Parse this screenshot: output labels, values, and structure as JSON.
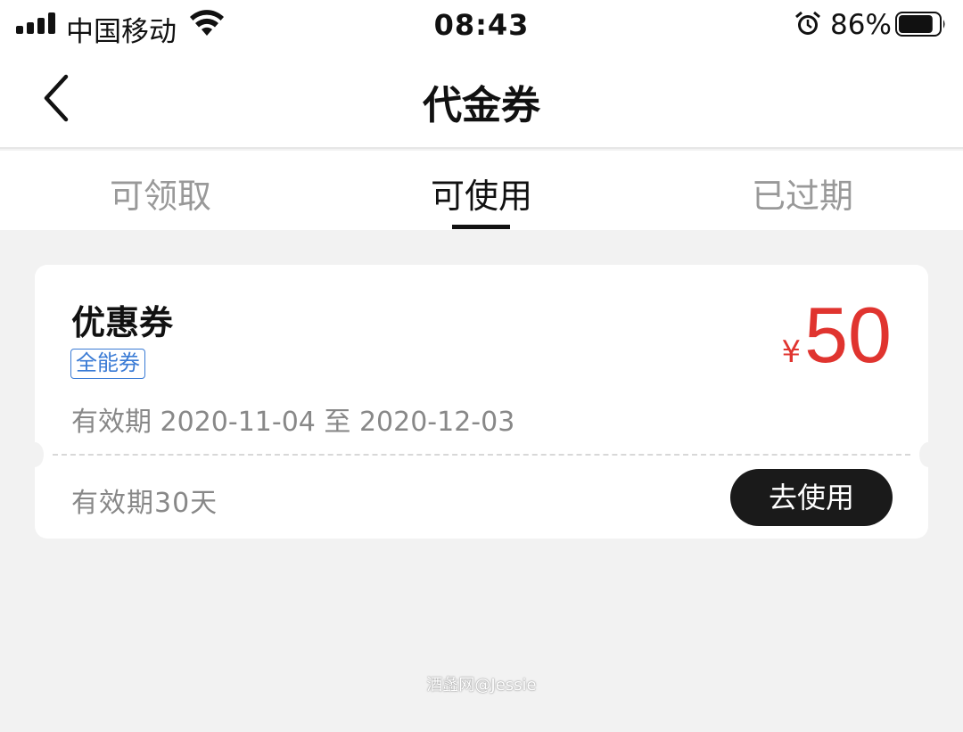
{
  "status_bar": {
    "carrier": "中国移动",
    "time": "08:43",
    "battery_percent": "86%",
    "battery_level": 0.86,
    "icons": [
      "signal-icon",
      "wifi-icon",
      "alarm-icon",
      "battery-icon"
    ]
  },
  "nav": {
    "title": "代金券",
    "back_icon": "chevron-left-icon"
  },
  "tabs": [
    {
      "label": "可领取",
      "active": false
    },
    {
      "label": "可使用",
      "active": true
    },
    {
      "label": "已过期",
      "active": false
    }
  ],
  "coupon": {
    "title": "优惠券",
    "tag": "全能券",
    "validity": "有效期 2020-11-04 至 2020-12-03",
    "currency": "¥",
    "amount": "50",
    "duration": "有效期30天",
    "button_label": "去使用"
  },
  "watermark": "酒蠡网@Jessie",
  "colors": {
    "accent_red": "#e0342f",
    "tag_blue": "#3a7bd5",
    "button_dark": "#1a1a1a",
    "background": "#f2f2f2"
  }
}
